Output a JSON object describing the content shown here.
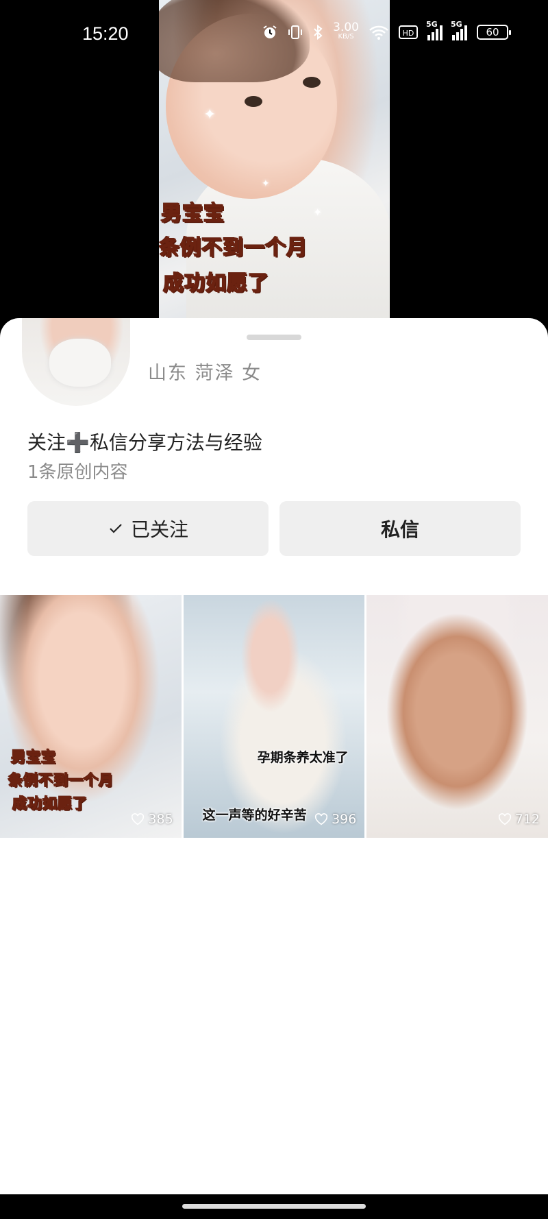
{
  "status_bar": {
    "time": "15:20",
    "net_speed": "3.00",
    "net_unit": "KB/S",
    "sim1": "5G",
    "sim2": "5G",
    "battery": "60"
  },
  "video": {
    "caption_lines": [
      "男宝宝",
      "条例不到一个月",
      "成功如愿了"
    ]
  },
  "profile": {
    "location": "山东 菏泽 女",
    "bio": "关注➕私信分享方法与经验",
    "original_count": "1条原创内容",
    "follow_button_label": "已关注",
    "message_button_label": "私信"
  },
  "posts": [
    {
      "caption_lines": [
        "男宝宝",
        "条例不到一个月",
        "成功如愿了"
      ],
      "likes": "385"
    },
    {
      "caption_lines": [
        "孕期条养太准了",
        "这一声等的好辛苦"
      ],
      "likes": "396"
    },
    {
      "caption_lines": [],
      "likes": "712"
    }
  ],
  "icons": {
    "check": "check-icon",
    "heart": "heart-icon",
    "alarm": "alarm-icon",
    "vibrate": "vibrate-icon",
    "bluetooth": "bluetooth-icon",
    "wifi": "wifi-icon"
  }
}
